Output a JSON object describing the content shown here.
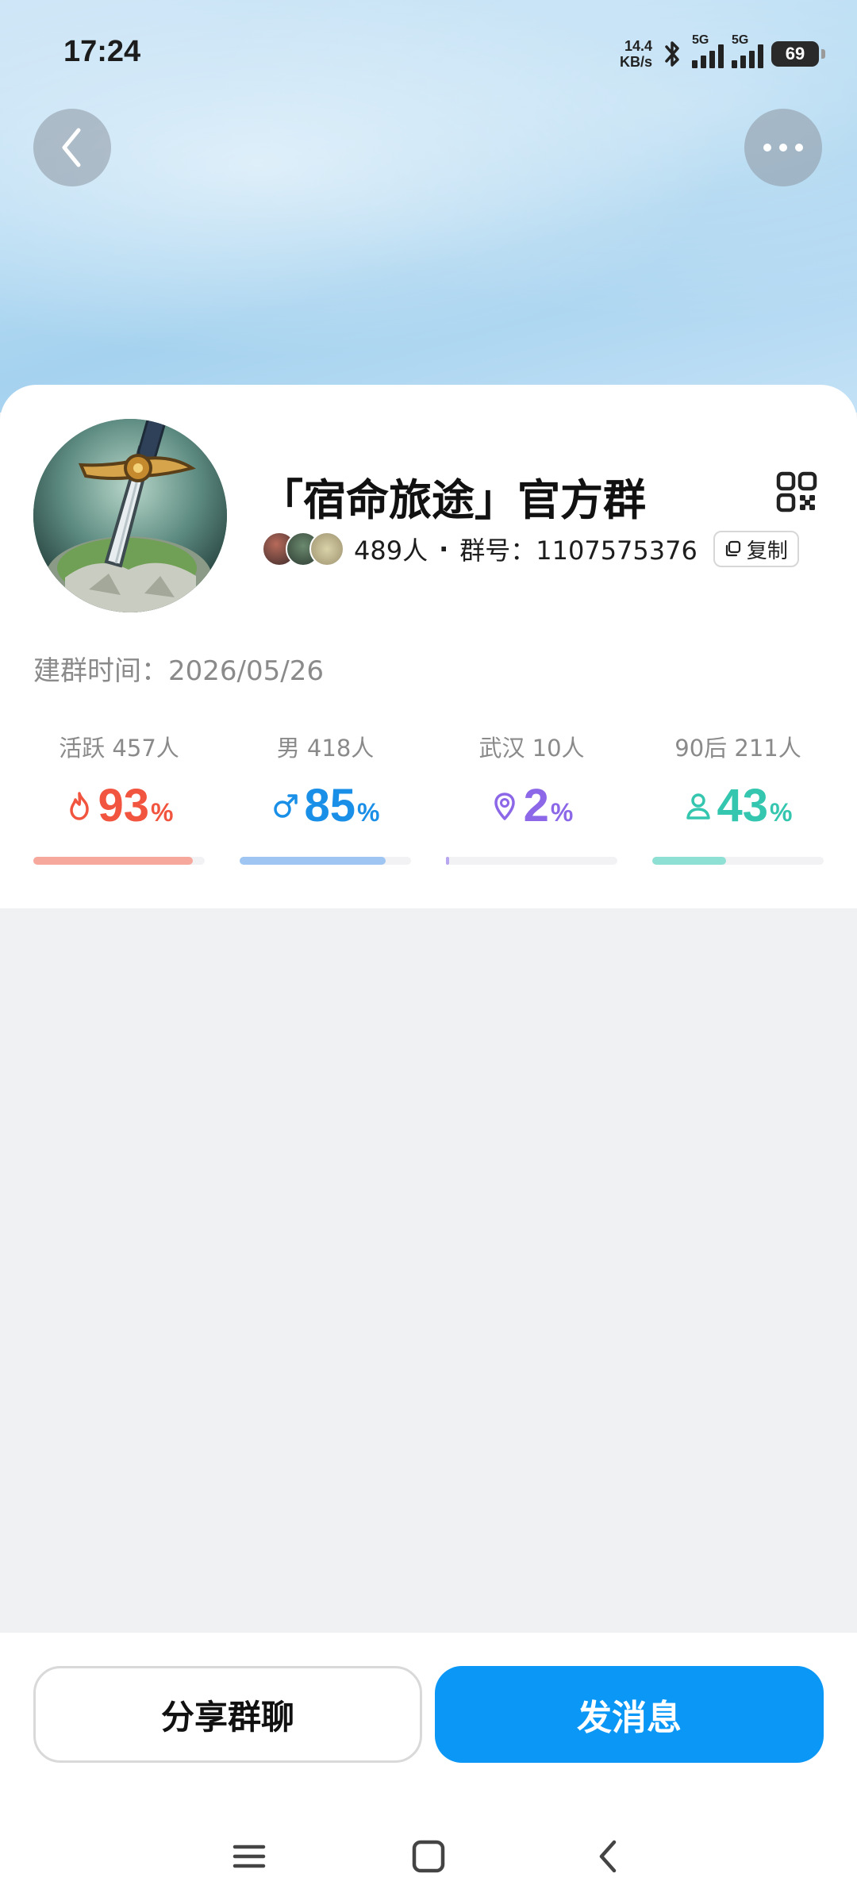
{
  "status_bar": {
    "time": "17:24",
    "net_speed_value": "14.4",
    "net_speed_unit": "KB/s",
    "sim1_label": "5G",
    "sim2_label": "5G",
    "battery": "69",
    "icons": [
      "bluetooth-icon",
      "signal-icon",
      "signal-icon",
      "battery-icon"
    ]
  },
  "header": {
    "back_icon": "chevron-left-icon",
    "more_icon": "more-horizontal-icon"
  },
  "group": {
    "name": "「宿命旅途」官方群",
    "member_count": "489人",
    "separator": "·",
    "group_id_text": "群号：1107575376",
    "copy_label": "复制",
    "created_text": "建群时间：2026/05/26",
    "avatar": "sword-in-stone-avatar",
    "qr_icon": "qr-code-icon"
  },
  "stats": [
    {
      "label": "活跃 457人",
      "value": "93",
      "unit": "%",
      "progress": 0.93,
      "color": "#f2553f",
      "track_color": "#f6a89c",
      "icon": "flame-icon"
    },
    {
      "label": "男 418人",
      "value": "85",
      "unit": "%",
      "progress": 0.85,
      "color": "#1a8fe8",
      "track_color": "#9fc6f2",
      "icon": "male-icon"
    },
    {
      "label": "武汉 10人",
      "value": "2",
      "unit": "%",
      "progress": 0.02,
      "color": "#8c68e8",
      "track_color": "#b9a6f0",
      "icon": "location-pin-icon"
    },
    {
      "label": "90后 211人",
      "value": "43",
      "unit": "%",
      "progress": 0.43,
      "color": "#35c6b0",
      "track_color": "#8fe0d4",
      "icon": "person-icon"
    }
  ],
  "actions": {
    "share_label": "分享群聊",
    "send_label": "发消息",
    "accent_color": "#0a97f6"
  },
  "nav_bar": {
    "icons": [
      "menu-icon",
      "home-square-icon",
      "back-icon"
    ]
  }
}
